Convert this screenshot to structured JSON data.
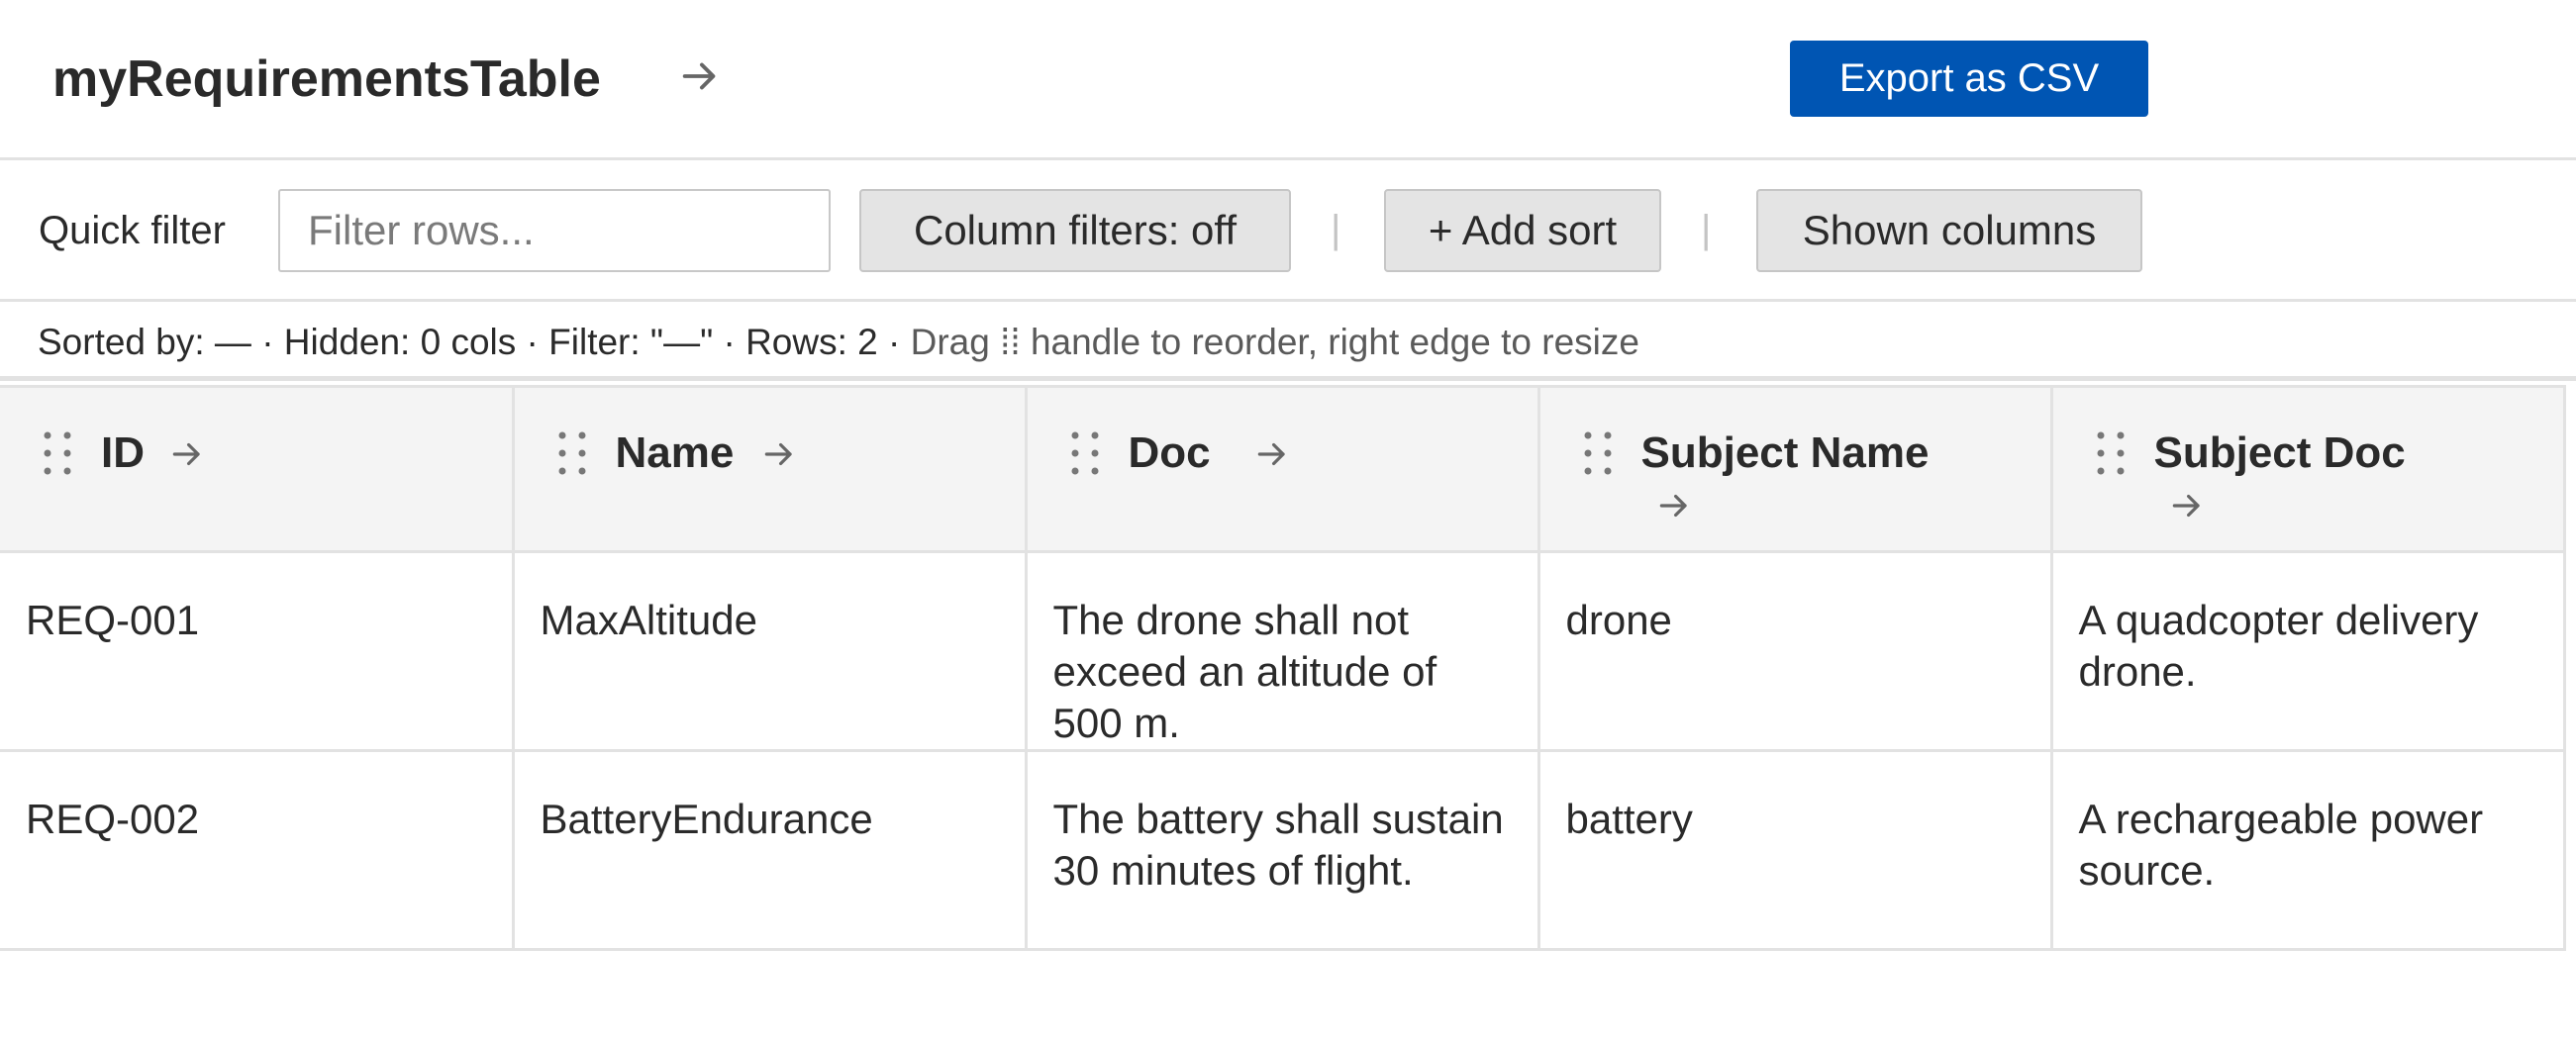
{
  "header": {
    "title": "myRequirementsTable",
    "title_arrow_icon": "arrow-right-icon",
    "export_label": "Export as CSV"
  },
  "colors": {
    "accent": "#0055b3",
    "header_bg": "#f4f4f4",
    "border": "#e2e2e2",
    "button_bg": "#e4e4e4"
  },
  "toolbar": {
    "quick_filter_label": "Quick filter",
    "filter_value": "",
    "filter_placeholder": "Filter rows...",
    "column_filters_label": "Column filters: off",
    "add_sort_label": "+ Add sort",
    "shown_columns_label": "Shown columns",
    "separator": "|"
  },
  "status": {
    "summary": "Sorted by: — · Hidden: 0 cols · Filter: \"—\" · Rows: 2 · ",
    "hint_before": "Drag ",
    "hint_icon": "⁞⁞",
    "hint_after": " handle to reorder, right edge to resize"
  },
  "table": {
    "columns": [
      {
        "label": "ID",
        "drag_icon": "drag-handle-icon",
        "sort_icon": "arrow-right-icon"
      },
      {
        "label": "Name",
        "drag_icon": "drag-handle-icon",
        "sort_icon": "arrow-right-icon"
      },
      {
        "label": "Doc",
        "drag_icon": "drag-handle-icon",
        "sort_icon": "arrow-right-icon"
      },
      {
        "label": "Subject Name",
        "drag_icon": "drag-handle-icon",
        "sort_icon": "arrow-right-icon"
      },
      {
        "label": "Subject Doc",
        "drag_icon": "drag-handle-icon",
        "sort_icon": "arrow-right-icon"
      }
    ],
    "rows": [
      {
        "id": "REQ-001",
        "name": "MaxAltitude",
        "doc": "The drone shall not exceed an altitude of 500 m.",
        "subject_name": "drone",
        "subject_doc": "A quadcopter delivery drone."
      },
      {
        "id": "REQ-002",
        "name": "BatteryEndurance",
        "doc": "The battery shall sustain 30 minutes of flight.",
        "subject_name": "battery",
        "subject_doc": "A rechargeable power source."
      }
    ]
  }
}
